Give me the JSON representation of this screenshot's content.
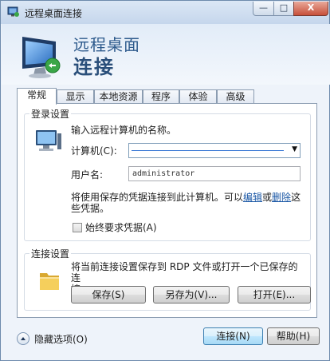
{
  "window": {
    "title": "远程桌面连接",
    "controls": {
      "minimize": "—",
      "maximize": "□",
      "close": "X"
    }
  },
  "header": {
    "line1": "远程桌面",
    "line2": "连接"
  },
  "tabs": [
    {
      "label": "常规",
      "active": true
    },
    {
      "label": "显示",
      "active": false
    },
    {
      "label": "本地资源",
      "active": false
    },
    {
      "label": "程序",
      "active": false
    },
    {
      "label": "体验",
      "active": false
    },
    {
      "label": "高级",
      "active": false
    }
  ],
  "login": {
    "legend": "登录设置",
    "instruction": "输入远程计算机的名称。",
    "computer_label": "计算机(C):",
    "computer_value": "",
    "username_label": "用户名:",
    "username_value": "administrator",
    "saved_note_prefix": "将使用保存的凭据连接到此计算机。可以",
    "edit_link": "编辑",
    "or_text": "或",
    "delete_link": "删除",
    "saved_note_suffix": "这",
    "saved_note_line2": "些凭据。",
    "always_ask_label": "始终要求凭据(A)",
    "always_ask_checked": false
  },
  "connection": {
    "legend": "连接设置",
    "description_line1": "将当前连接设置保存到 RDP 文件或打开一个已保存的连",
    "description_line2": "接。",
    "save_button": "保存(S)",
    "save_as_button": "另存为(V)...",
    "open_button": "打开(E)..."
  },
  "footer": {
    "hide_options": "隐藏选项(O)",
    "connect_button": "连接(N)",
    "help_button": "帮助(H)"
  },
  "colors": {
    "title_blue": "#2d5a8c",
    "link_blue": "#1a57a5",
    "close_red": "#c7503a"
  }
}
